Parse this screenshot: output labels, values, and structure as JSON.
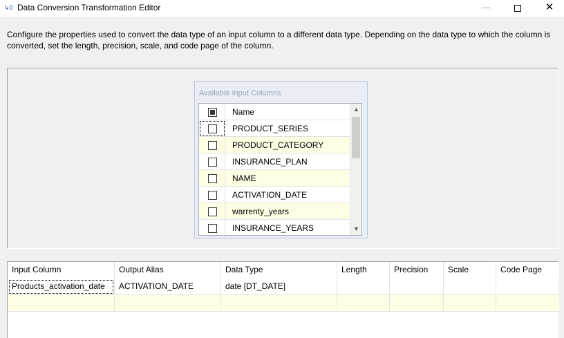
{
  "window": {
    "title": "Data Conversion Transformation Editor",
    "icon": "data-conversion-icon",
    "icon_glyph": "↳0",
    "minimize_glyph": "—",
    "close_glyph": "✕"
  },
  "description": "Configure the properties used to convert the data type of an input column to a different data type. Depending on the data type to which the column is converted, set the length, precision, scale, and code page of the column.",
  "available_columns": {
    "title": "Available Input Columns",
    "header_name": "Name",
    "header_checkbox": "indeterminate",
    "rows": [
      {
        "name": "PRODUCT_SERIES",
        "checked": false
      },
      {
        "name": "PRODUCT_CATEGORY",
        "checked": false
      },
      {
        "name": "INSURANCE_PLAN",
        "checked": false
      },
      {
        "name": "NAME",
        "checked": false
      },
      {
        "name": "ACTIVATION_DATE",
        "checked": false
      },
      {
        "name": "warrenty_years",
        "checked": false
      },
      {
        "name": "INSURANCE_YEARS",
        "checked": false
      }
    ],
    "scroll_up_glyph": "▲",
    "scroll_down_glyph": "▼"
  },
  "conversion_table": {
    "headers": [
      "Input Column",
      "Output Alias",
      "Data Type",
      "Length",
      "Precision",
      "Scale",
      "Code Page"
    ],
    "rows": [
      {
        "input_column": "Products_activation_date",
        "output_alias": "ACTIVATION_DATE",
        "data_type": "date [DT_DATE]",
        "length": "",
        "precision": "",
        "scale": "",
        "code_page": ""
      }
    ]
  },
  "colors": {
    "alt_row": "#fefee4",
    "input_box_bg": "#e9eef6",
    "window_bg": "#f0f0f0"
  }
}
